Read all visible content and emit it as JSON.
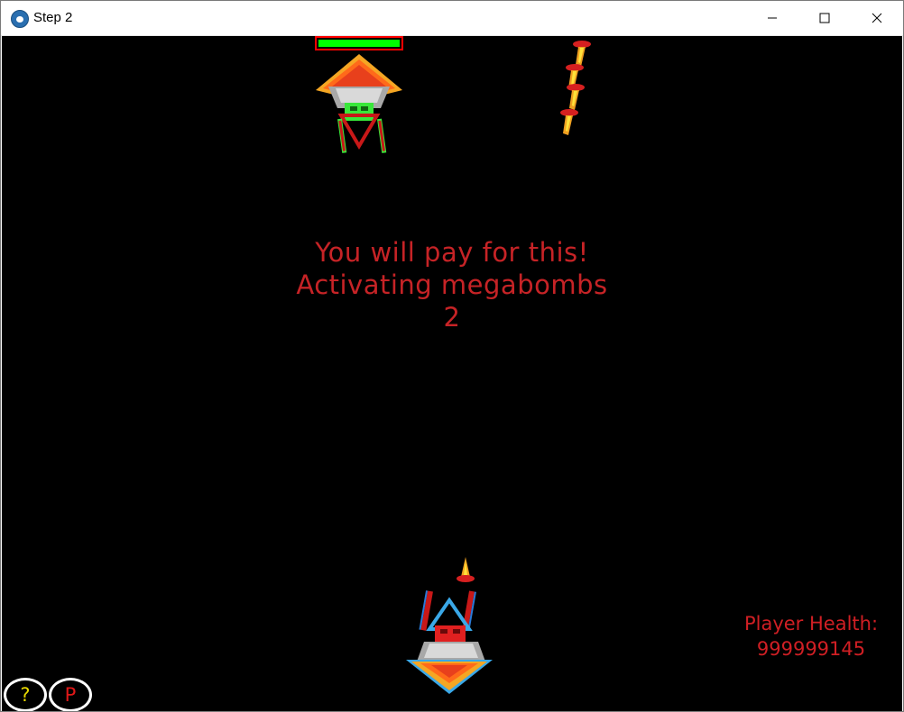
{
  "window": {
    "title": "Step 2",
    "icon": "paw-app-icon",
    "controls": [
      "minimize-icon",
      "maximize-icon",
      "close-icon"
    ]
  },
  "game": {
    "message": {
      "line1": "You will pay for this!",
      "line2": "Activating megabombs",
      "line3": "2"
    },
    "player_health": {
      "label": "Player Health:",
      "value": "999999145"
    },
    "boss_health_fraction": 1.0,
    "buttons": {
      "help_label": "?",
      "pause_label": "P"
    },
    "colors": {
      "background": "#000000",
      "message": "#c62326",
      "health_text": "#d01f24",
      "boss_health_bar": "#00ff00",
      "boss_health_border": "#ff0000",
      "help_button_text": "#e8d800",
      "pause_button_text": "#e01818"
    }
  }
}
